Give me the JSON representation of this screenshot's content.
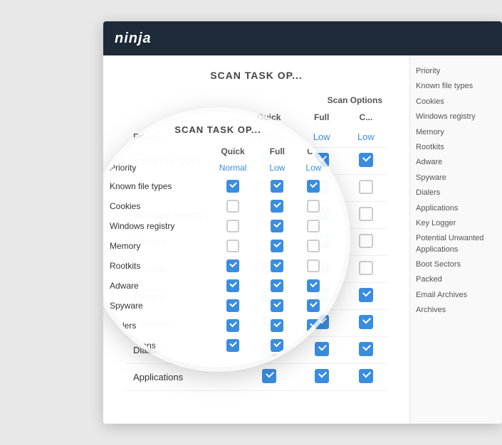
{
  "navbar": {
    "logo": "ninja"
  },
  "panel": {
    "title": "SCAN TASK OP...",
    "columns": {
      "label": "",
      "quick": "Quick",
      "full": "Full",
      "custom": "C..."
    },
    "scan_options_label": "Scan Options"
  },
  "rows": [
    {
      "label": "Priority",
      "quick": "priority_normal",
      "full": "priority_low",
      "custom": "priority_low"
    },
    {
      "label": "Known file types",
      "quick": "checked",
      "full": "checked",
      "custom": "checked"
    },
    {
      "label": "Cookies",
      "quick": "unchecked",
      "full": "checked",
      "custom": "unchecked"
    },
    {
      "label": "Windows registry",
      "quick": "unchecked",
      "full": "checked",
      "custom": "unchecked"
    },
    {
      "label": "Memory",
      "quick": "unchecked",
      "full": "checked",
      "custom": "unchecked"
    },
    {
      "label": "Rootkits",
      "quick": "checked",
      "full": "checked",
      "custom": "unchecked"
    },
    {
      "label": "Adware",
      "quick": "checked",
      "full": "checked",
      "custom": "checked"
    },
    {
      "label": "Spyware",
      "quick": "checked",
      "full": "checked",
      "custom": "partial"
    },
    {
      "label": "Dialers",
      "quick": "checked",
      "full": "checked",
      "custom": "checked"
    },
    {
      "label": "Applications",
      "quick": "checked",
      "full": "checked",
      "custom": "checked"
    }
  ],
  "magnifier": {
    "title": "SCAN TASK OP...",
    "cols": [
      "",
      "Quick",
      "Full",
      "C..."
    ],
    "rows": [
      {
        "label": "Priority",
        "quick": "Normal",
        "full": "Low",
        "custom": "Low"
      },
      {
        "label": "Known file types",
        "quick": "checked",
        "full": "checked",
        "custom": "checked"
      },
      {
        "label": "Cookies",
        "quick": "unchecked",
        "full": "checked",
        "custom": "unchecked"
      },
      {
        "label": "Windows registry",
        "quick": "unchecked",
        "full": "checked",
        "custom": "unchecked"
      },
      {
        "label": "Memory",
        "quick": "unchecked",
        "full": "checked",
        "custom": "unchecked"
      },
      {
        "label": "Rootkits",
        "quick": "checked",
        "full": "checked",
        "custom": "unchecked"
      },
      {
        "label": "Adware",
        "quick": "checked",
        "full": "checked",
        "custom": "checked"
      },
      {
        "label": "Spyware",
        "quick": "checked",
        "full": "checked",
        "custom": "partial"
      },
      {
        "label": "Dialers",
        "quick": "checked",
        "full": "checked",
        "custom": "checked"
      },
      {
        "label": "Applications",
        "quick": "checked",
        "full": "checked",
        "custom": "checked"
      }
    ]
  },
  "sidebar": {
    "items": [
      "Priority",
      "Known file types",
      "Cookies",
      "Windows registry",
      "Memory",
      "Rootkits",
      "Adware",
      "Spyware",
      "Dialers",
      "Applications",
      "Key Logger",
      "Potential Unwanted Applications",
      "Boot Sectors",
      "Packed",
      "Email Archives",
      "Archives"
    ]
  }
}
